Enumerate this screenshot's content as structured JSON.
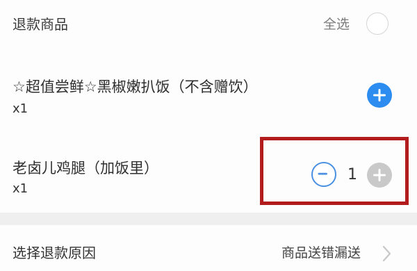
{
  "header": {
    "title": "退款商品",
    "select_all_label": "全选"
  },
  "items": [
    {
      "name": "☆超值尝鲜☆黑椒嫩扒饭（不含赠饮）",
      "qty": "x1",
      "action_icon": "plus-circle-icon"
    },
    {
      "name": "老卤儿鸡腿（加饭里）",
      "qty": "x1",
      "stepper": {
        "value": "1",
        "minus_icon": "minus-circle-icon",
        "plus_icon": "plus-circle-icon"
      }
    }
  ],
  "reason": {
    "label": "选择退款原因",
    "value": "商品送错漏送",
    "icon": "chevron-right-icon"
  },
  "colors": {
    "accent_blue": "#2d8cf0",
    "highlight_red": "#b21c1c",
    "disabled_gray": "#c9c9c9"
  }
}
